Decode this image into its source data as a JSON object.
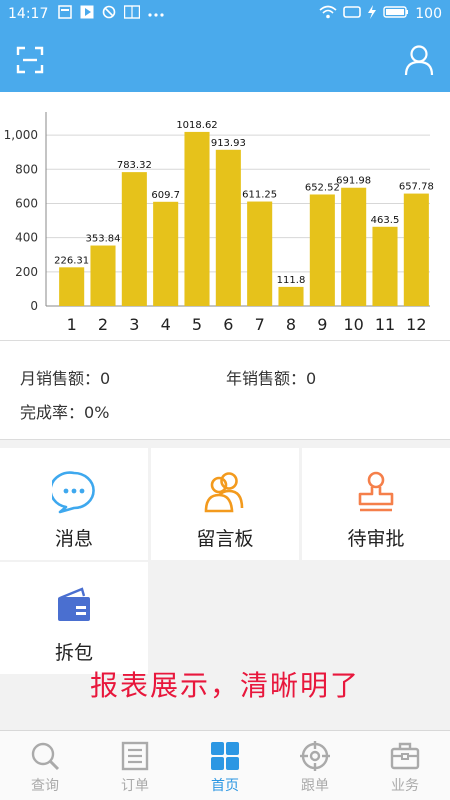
{
  "status_bar": {
    "time": "14:17",
    "battery": "100"
  },
  "chart_data": {
    "type": "bar",
    "categories": [
      "1",
      "2",
      "3",
      "4",
      "5",
      "6",
      "7",
      "8",
      "9",
      "10",
      "11",
      "12"
    ],
    "values": [
      226.31,
      353.84,
      783.32,
      609.7,
      1018.62,
      913.93,
      611.25,
      111.8,
      652.52,
      691.98,
      463.5,
      657.78
    ],
    "data_labels": [
      "226.31",
      "353.84",
      "783.32",
      "609.7",
      "1018.62",
      "913.93",
      "611.25",
      "111.8",
      "652.52",
      "691.98",
      "463.5",
      "657.78"
    ],
    "y_ticks": [
      "0",
      "200",
      "400",
      "600",
      "800",
      "1,000"
    ],
    "y_tick_values": [
      0,
      200,
      400,
      600,
      800,
      1000
    ],
    "ylim": [
      0,
      1100
    ],
    "bar_color": "#e6c21b",
    "grid": true
  },
  "sales": {
    "monthly_label": "月销售额：",
    "monthly_value": "0",
    "yearly_label": "年销售额：",
    "yearly_value": "0",
    "completion_label": "完成率：",
    "completion_value": "0%"
  },
  "tiles": [
    {
      "label": "消息",
      "icon": "chat-bubble-icon",
      "color": "#3ea8ee"
    },
    {
      "label": "留言板",
      "icon": "people-icon",
      "color": "#f39a1d"
    },
    {
      "label": "待审批",
      "icon": "stamp-icon",
      "color": "#f57f4a"
    },
    {
      "label": "拆包",
      "icon": "wallet-icon",
      "color": "#4a6fd0"
    }
  ],
  "banner": "报表展示，清晰明了",
  "nav": [
    {
      "label": "查询",
      "icon": "search-icon"
    },
    {
      "label": "订单",
      "icon": "order-list-icon"
    },
    {
      "label": "首页",
      "icon": "home-grid-icon",
      "active": true
    },
    {
      "label": "跟单",
      "icon": "target-icon"
    },
    {
      "label": "业务",
      "icon": "briefcase-icon"
    }
  ],
  "colors": {
    "primary": "#4aaaec",
    "accent": "#2c97e3",
    "banner": "#e8173c",
    "nav_inactive": "#aaaaaa"
  }
}
